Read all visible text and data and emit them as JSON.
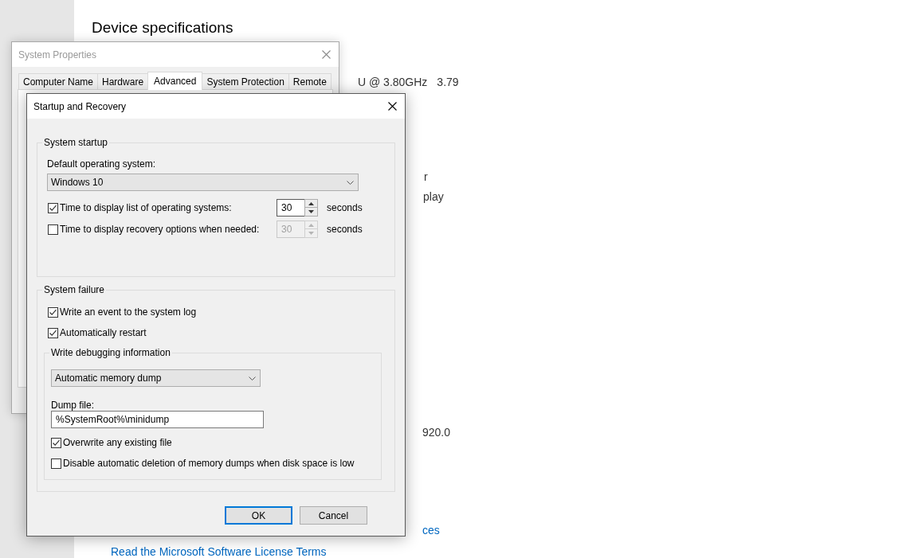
{
  "settings_page": {
    "heading": "Device specifications",
    "partial_rows": [
      {
        "kind": "text",
        "texts": [
          "U @ 3.80GHz",
          "3.79"
        ]
      },
      {
        "kind": "text",
        "texts": [
          "r"
        ]
      },
      {
        "kind": "text",
        "texts": [
          "play"
        ]
      },
      {
        "kind": "text",
        "texts": [
          "920.0"
        ]
      },
      {
        "kind": "link",
        "texts": [
          "ces"
        ]
      },
      {
        "kind": "link",
        "texts": [
          "Read the Microsoft Software License Terms"
        ]
      }
    ]
  },
  "system_properties": {
    "title": "System Properties",
    "active": false,
    "tabs": [
      {
        "label": "Computer Name",
        "selected": false
      },
      {
        "label": "Hardware",
        "selected": false
      },
      {
        "label": "Advanced",
        "selected": true
      },
      {
        "label": "System Protection",
        "selected": false
      },
      {
        "label": "Remote",
        "selected": false
      }
    ]
  },
  "startup_and_recovery": {
    "title": "Startup and Recovery",
    "active": true,
    "system_startup": {
      "legend": "System startup",
      "default_os_label": "Default operating system:",
      "default_os": "Windows 10",
      "timeouts": [
        {
          "label": "Time to display list of operating systems:",
          "checked": true,
          "value": "30",
          "disabled": false,
          "unit": "seconds"
        },
        {
          "label": "Time to display recovery options when needed:",
          "checked": false,
          "value": "30",
          "disabled": true,
          "unit": "seconds"
        }
      ]
    },
    "system_failure": {
      "legend": "System failure",
      "options": [
        {
          "label": "Write an event to the system log",
          "checked": true
        },
        {
          "label": "Automatically restart",
          "checked": true
        }
      ],
      "debugging": {
        "legend": "Write debugging information",
        "dump_type": "Automatic memory dump",
        "dump_file_label": "Dump file:",
        "dump_file": "%SystemRoot%\\minidump",
        "options": [
          {
            "label": "Overwrite any existing file",
            "checked": true
          },
          {
            "label": "Disable automatic deletion of memory dumps when disk space is low",
            "checked": false
          }
        ]
      }
    },
    "buttons": [
      {
        "label": "OK",
        "default": true
      },
      {
        "label": "Cancel",
        "default": false
      }
    ]
  }
}
